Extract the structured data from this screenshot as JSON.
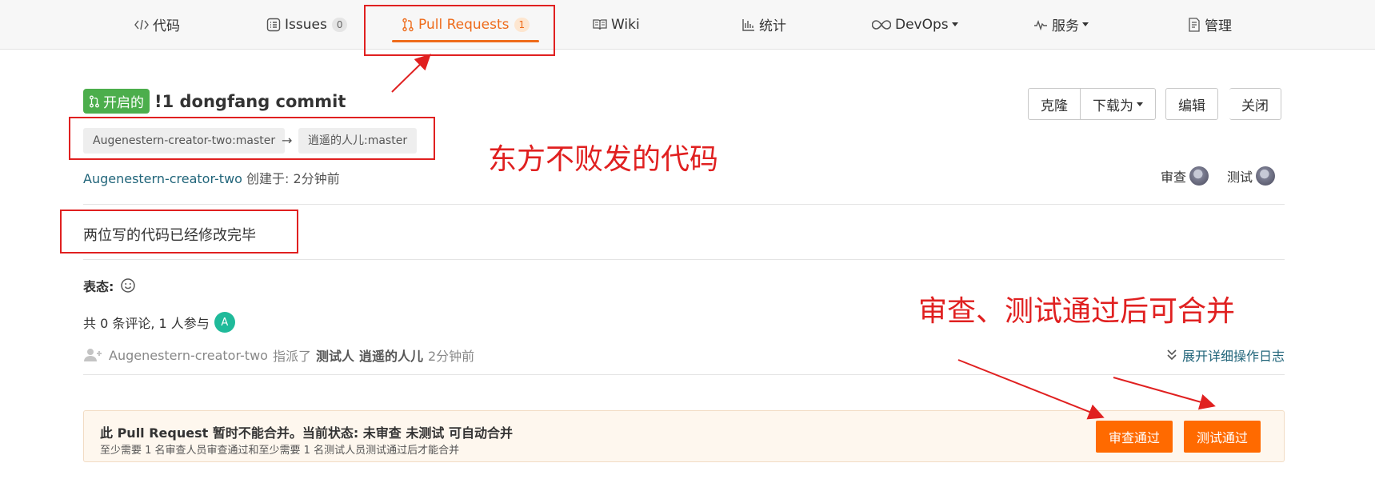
{
  "nav": {
    "tabs": [
      {
        "label": "代码",
        "icon": "code-icon"
      },
      {
        "label": "Issues",
        "count": "0",
        "icon": "issue-icon"
      },
      {
        "label": "Pull Requests",
        "count": "1",
        "icon": "pull-request-icon",
        "active": true
      },
      {
        "label": "Wiki",
        "icon": "book-icon"
      },
      {
        "label": "统计",
        "icon": "bar-chart-icon"
      },
      {
        "label": "DevOps",
        "icon": "infinity-icon",
        "dropdown": true
      },
      {
        "label": "服务",
        "icon": "pulse-icon",
        "dropdown": true
      },
      {
        "label": "管理",
        "icon": "document-icon"
      }
    ]
  },
  "pr": {
    "state": "开启的",
    "title": "!1 dongfang commit",
    "source_branch": "Augenestern-creator-two:master",
    "arrow": "→",
    "target_branch": "逍遥的人儿:master",
    "author": "Augenestern-creator-two",
    "created_label": " 创建于:   2分钟前",
    "description": "两位写的代码已经修改完毕"
  },
  "actions": {
    "clone": "克隆",
    "download": "下载为",
    "edit": "编辑",
    "close": "关闭"
  },
  "reviewers": {
    "review_label": "审查",
    "test_label": "测试"
  },
  "reactions": {
    "label": "表态:"
  },
  "comments": {
    "text": "共 0 条评论, 1 人参与",
    "avatar_letter": "A"
  },
  "event": {
    "actor": "Augenestern-creator-two",
    "verb": "指派了",
    "role": "测试人",
    "target": "逍遥的人儿",
    "time": "2分钟前"
  },
  "expand_log": "展开详细操作日志",
  "merge": {
    "title": "此 Pull Request 暂时不能合并。当前状态: 未审查 未测试 可自动合并",
    "subtitle": "至少需要 1 名审查人员审查通过和至少需要 1 名测试人员测试通过后才能合并",
    "review_pass": "审查通过",
    "test_pass": "测试通过"
  },
  "annotations": {
    "note_code": "东方不败发的代码",
    "note_merge": "审查、测试通过后可合并"
  },
  "colors": {
    "accent": "#ee6b1a",
    "annotation": "#e02020",
    "open_state": "#4cae4c",
    "merge_button": "#ff6a00"
  }
}
